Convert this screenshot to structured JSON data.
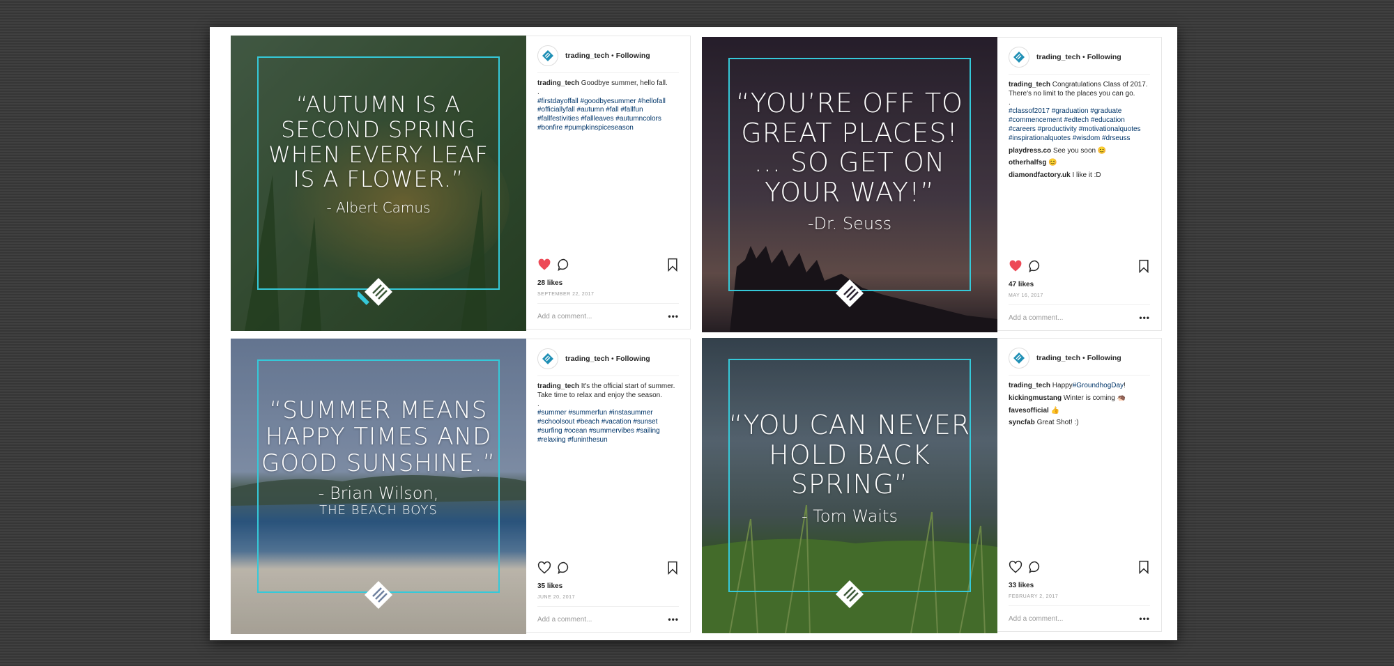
{
  "posts": [
    {
      "quote": "“AUTUMN IS A SECOND SPRING WHEN EVERY LEAF IS A FLOWER.”",
      "author": "- Albert Camus",
      "author_sub": "",
      "username": "trading_tech",
      "separator": "•",
      "follow": "Following",
      "caption": "Goodbye summer, hello fall.",
      "caption_dot": ".",
      "tags": "#firstdayoffall #goodbyesummer #hellofall #officiallyfall #autumn #fall #fallfun #fallfestivities #fallleaves #autumncolors #bonfire #pumpkinspiceseason",
      "comments": [],
      "liked": true,
      "likes": "28 likes",
      "date": "SEPTEMBER 22, 2017",
      "add_comment": "Add a comment...",
      "more": "•••"
    },
    {
      "quote": "“YOU’RE OFF TO GREAT PLACES! ... SO GET ON YOUR WAY!”",
      "author": "-Dr. Seuss",
      "author_sub": "",
      "username": "trading_tech",
      "separator": "•",
      "follow": "Following",
      "caption": "Congratulations Class of 2017. There's no limit to the places you can go.",
      "caption_dot": ".",
      "tags": "#classof2017 #graduation #graduate #commencement #edtech #education #careers #productivity #motivationalquotes #inspirationalquotes #wisdom #drseuss",
      "comments": [
        {
          "user": "playdress.co",
          "text": "See you soon 😊"
        },
        {
          "user": "otherhalfsg",
          "text": "😊"
        },
        {
          "user": "diamondfactory.uk",
          "text": "I like it :D"
        }
      ],
      "liked": true,
      "likes": "47 likes",
      "date": "MAY 16, 2017",
      "add_comment": "Add a comment...",
      "more": "•••"
    },
    {
      "quote": "“SUMMER MEANS HAPPY TIMES AND GOOD SUNSHINE.”",
      "author": "- Brian Wilson,",
      "author_sub": "THE BEACH BOYS",
      "username": "trading_tech",
      "separator": "•",
      "follow": "Following",
      "caption": "It's the official start of summer. Take time to relax and enjoy the season.",
      "caption_dot": ".",
      "tags": "#summer #summerfun #instasummer #schoolsout #beach #vacation #sunset #surfing #ocean #summervibes #sailing #relaxing #funinthesun",
      "comments": [],
      "liked": false,
      "likes": "35 likes",
      "date": "JUNE 20, 2017",
      "add_comment": "Add a comment...",
      "more": "•••"
    },
    {
      "quote": "“YOU CAN NEVER HOLD BACK SPRING”",
      "author": "- Tom Waits",
      "author_sub": "",
      "username": "trading_tech",
      "separator": "•",
      "follow": "Following",
      "caption": "Happy",
      "caption_link": "#GroundhogDay",
      "caption_end": "!",
      "caption_dot": "",
      "tags": "",
      "comments": [
        {
          "user": "kickingmustang",
          "text": "Winter is coming 🦔"
        },
        {
          "user": "favesofficial",
          "text": "👍"
        },
        {
          "user": "syncfab",
          "text": "Great Shot! :)"
        }
      ],
      "liked": false,
      "likes": "33 likes",
      "date": "FEBRUARY 2, 2017",
      "add_comment": "Add a comment...",
      "more": "•••"
    }
  ],
  "colors": {
    "accent_frame": "#35c9d9",
    "heart_liked": "#ed4956",
    "hashtag": "#003569"
  }
}
